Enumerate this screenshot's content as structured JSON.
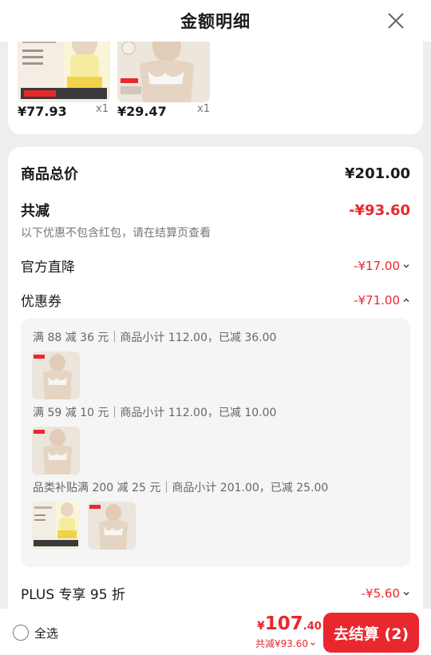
{
  "header": {
    "title": "金额明细"
  },
  "products": [
    {
      "price": "¥77.93",
      "qty": "x1"
    },
    {
      "price": "¥29.47",
      "qty": "x1"
    }
  ],
  "summary": {
    "total_label": "商品总价",
    "total_value": "¥201.00",
    "reduce_label": "共减",
    "reduce_value": "-¥93.60",
    "reduce_note": "以下优惠不包含红包，请在结算页查看",
    "official_label": "官方直降",
    "official_value": "-¥17.00",
    "coupon_label": "优惠券",
    "coupon_value": "-¥71.00",
    "plus_label": "PLUS 专享 95 折",
    "plus_value": "-¥5.60"
  },
  "coupons": [
    {
      "text": "满 88 减 36 元｜商品小计 112.00，已减 36.00"
    },
    {
      "text": "满 59 减 10 元｜商品小计 112.00，已减 10.00"
    },
    {
      "text": "品类补贴满 200 减 25 元｜商品小计 201.00，已减 25.00"
    }
  ],
  "footer": {
    "select_all": "全选",
    "price_yen": "¥",
    "price_int": "107",
    "price_dec": ".40",
    "save_text": "共减¥93.60",
    "checkout": "去结算 (2)"
  },
  "colors": {
    "accent": "#e8282e",
    "background": "#eeeeee",
    "card": "#ffffff",
    "coupon_bg": "#f5f5f5"
  }
}
